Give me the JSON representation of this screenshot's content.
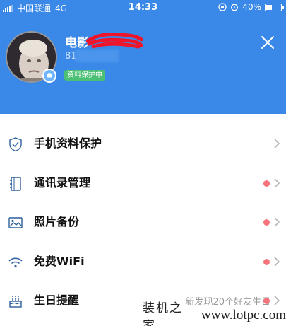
{
  "status_bar": {
    "carrier": "中国联通",
    "network": "4G",
    "time": "14:33",
    "battery": "40%",
    "battery_level": 0.4
  },
  "profile": {
    "name": "电影",
    "id_prefix": "81",
    "protect_badge": "资料保护中"
  },
  "menu": [
    {
      "label": "手机资料保护",
      "icon": "shield-icon",
      "has_dot": false,
      "hint": ""
    },
    {
      "label": "通讯录管理",
      "icon": "contacts-book-icon",
      "has_dot": true,
      "hint": ""
    },
    {
      "label": "照片备份",
      "icon": "photo-icon",
      "has_dot": true,
      "hint": ""
    },
    {
      "label": "免费WiFi",
      "icon": "wifi-icon",
      "has_dot": true,
      "hint": ""
    },
    {
      "label": "生日提醒",
      "icon": "birthday-cake-icon",
      "has_dot": true,
      "hint": "新发现20个好友生日"
    }
  ],
  "watermark": {
    "text": "装机之家",
    "url": "www.lotpc.com"
  },
  "colors": {
    "header_bg": "#3a88e8",
    "badge_green": "#4bbf73",
    "dot_red": "#f4737c",
    "redaction": "#f0142a"
  }
}
